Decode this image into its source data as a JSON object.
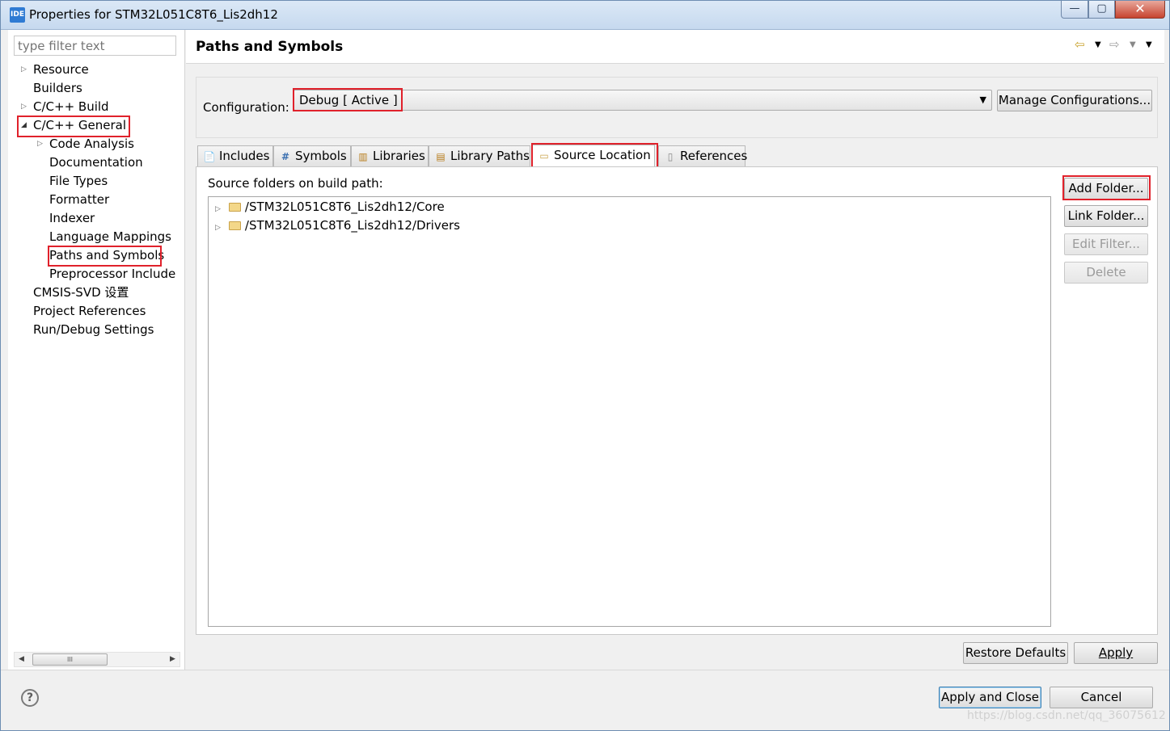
{
  "window": {
    "app_icon": "IDE",
    "title": "Properties for STM32L051C8T6_Lis2dh12",
    "controls": {
      "minimize": "—",
      "maximize": "▢",
      "close": "✕"
    }
  },
  "sidebar": {
    "filter_placeholder": "type filter text",
    "items": [
      {
        "label": "Resource"
      },
      {
        "label": "Builders"
      },
      {
        "label": "C/C++ Build"
      },
      {
        "label": "C/C++ General"
      },
      {
        "label": "Code Analysis"
      },
      {
        "label": "Documentation"
      },
      {
        "label": "File Types"
      },
      {
        "label": "Formatter"
      },
      {
        "label": "Indexer"
      },
      {
        "label": "Language Mappings"
      },
      {
        "label": "Paths and Symbols"
      },
      {
        "label": "Preprocessor Include"
      },
      {
        "label": "CMSIS-SVD 设置"
      },
      {
        "label": "Project References"
      },
      {
        "label": "Run/Debug Settings"
      }
    ],
    "scroll_thumb": "III"
  },
  "page": {
    "title": "Paths and Symbols",
    "configuration_label": "Configuration:",
    "configuration_value": "Debug  [ Active ]",
    "manage_button": "Manage Configurations...",
    "tabs": [
      {
        "label": "Includes",
        "icon": "include-icon"
      },
      {
        "label": "Symbols",
        "icon": "hash-icon"
      },
      {
        "label": "Libraries",
        "icon": "library-icon"
      },
      {
        "label": "Library Paths",
        "icon": "library-path-icon"
      },
      {
        "label": "Source Location",
        "icon": "source-folder-icon"
      },
      {
        "label": "References",
        "icon": "reference-icon"
      }
    ],
    "active_tab": "Source Location",
    "source_label": "Source folders on build path:",
    "source_folders": [
      "/STM32L051C8T6_Lis2dh12/Core",
      "/STM32L051C8T6_Lis2dh12/Drivers"
    ],
    "side_buttons": {
      "add_folder": "Add Folder...",
      "link_folder": "Link Folder...",
      "edit_filter": "Edit Filter...",
      "delete": "Delete"
    },
    "restore_defaults": "Restore Defaults",
    "apply": "Apply"
  },
  "footer": {
    "help": "?",
    "apply_and_close": "Apply and Close",
    "cancel": "Cancel",
    "watermark": "https://blog.csdn.net/qq_36075612"
  },
  "highlight_color": "#e0212b"
}
